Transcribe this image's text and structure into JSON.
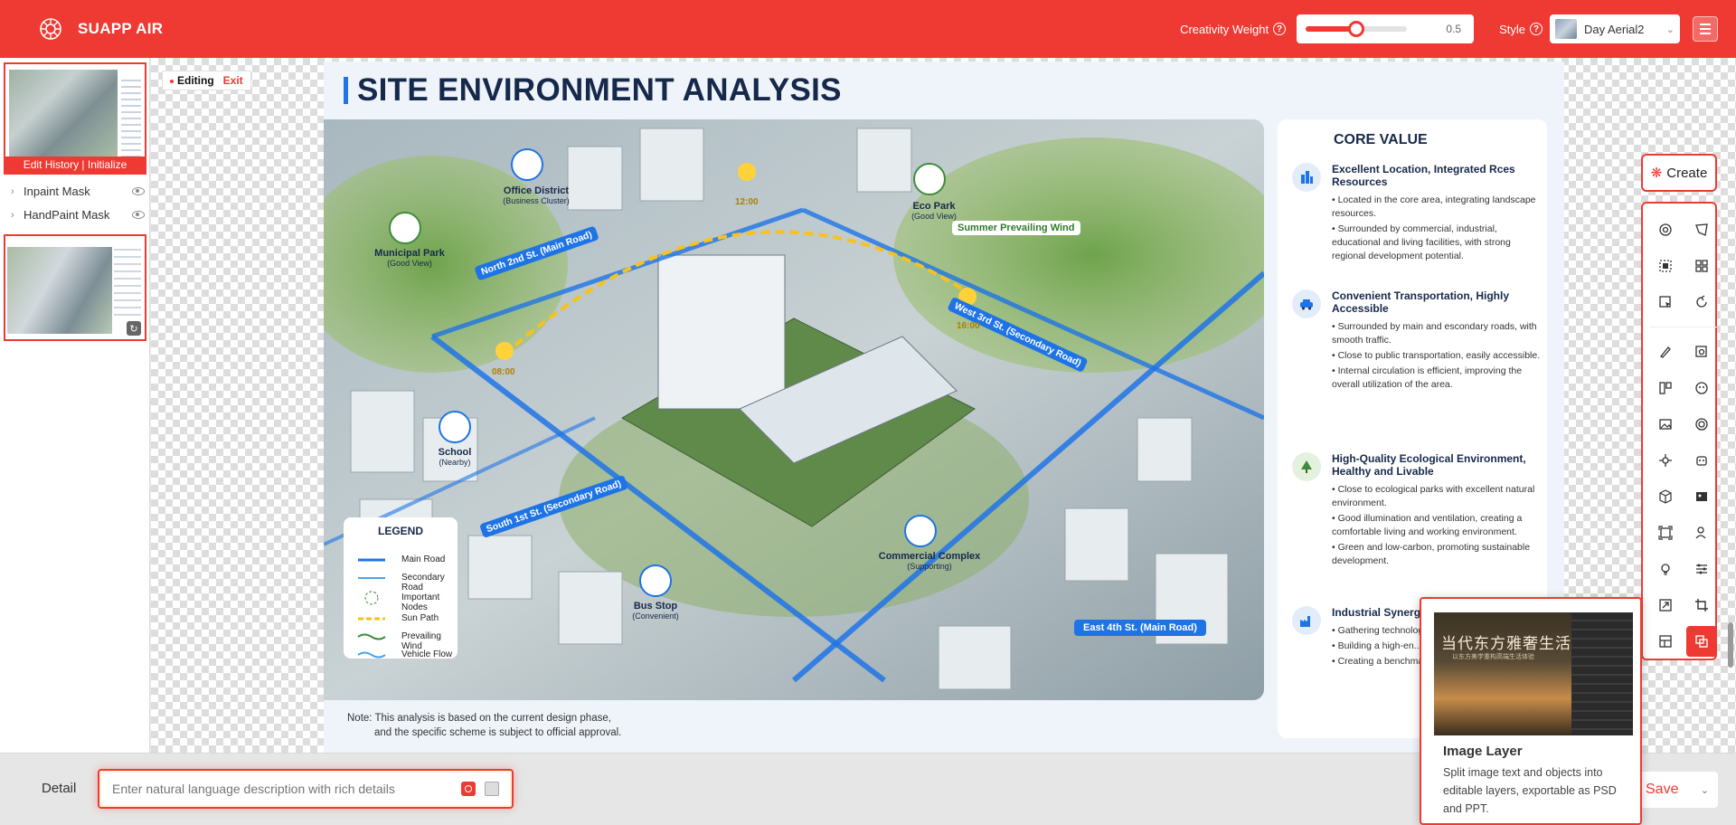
{
  "app": {
    "name": "SUAPP AIR"
  },
  "header": {
    "creativity_label": "Creativity Weight",
    "creativity_value": 0.5,
    "creativity_value_text": "0.5",
    "style_label": "Style",
    "style_value": "Day Aerial2",
    "help_glyph": "?"
  },
  "left_panel": {
    "thumb1_bar": "Edit History | Initialize",
    "layers": [
      {
        "label": "Inpaint Mask"
      },
      {
        "label": "HandPaint Mask"
      }
    ]
  },
  "canvas": {
    "editing_label": "Editing",
    "exit_label": "Exit"
  },
  "poster": {
    "title": "SITE ENVIRONMENT ANALYSIS",
    "note_line1": "Note: This analysis is based on the current design phase,",
    "note_line2": "and the specific scheme is subject to official approval.",
    "map_labels": {
      "office": "Office District",
      "office_sub": "(Business Cluster)",
      "municipal": "Municipal Park",
      "municipal_sub": "(Good View)",
      "eco": "Eco Park",
      "eco_sub": "(Good View)",
      "wind": "Summer Prevailing Wind",
      "north_road": "North 2nd St. (Main Road)",
      "west_road": "West 3rd St. (Secondary Road)",
      "south_road": "South 1st St. (Secondary Road)",
      "east_road": "East 4th St. (Main Road)",
      "school": "School",
      "school_sub": "(Nearby)",
      "bus": "Bus Stop",
      "bus_sub": "(Convenient)",
      "commercial": "Commercial Complex",
      "commercial_sub": "(Supporting)",
      "t1": "08:00",
      "t2": "12:00",
      "t3": "16:00"
    },
    "legend": {
      "title": "LEGEND",
      "items": [
        "Main Road",
        "Secondary Road",
        "Important Nodes",
        "Sun Path",
        "Prevailing Wind",
        "Vehicle Flow"
      ]
    },
    "core_value": {
      "title": "CORE VALUE",
      "items": [
        {
          "head": "Excellent Location, Integrated Rces Resources",
          "bullets": [
            "• Located in the core area, integrating landscape resources.",
            "• Surrounded by commercial, industrial, educational and living facilities, with strong regional development potential."
          ]
        },
        {
          "head": "Convenient Transportation, Highly Accessible",
          "bullets": [
            "• Surrounded by main and escondary roads, with smooth traffic.",
            "• Close to public transportation, easily accessible.",
            "• Internal circulation is efficient, improving the overall utilization of the area."
          ]
        },
        {
          "head": "High-Quality Ecological Environment, Healthy and Livable",
          "bullets": [
            "• Close to ecological parks with excellent natural environment.",
            "• Good illumination and ventilation, creating a comfortable living and working environment.",
            "• Green and low-carbon, promoting sustainable development."
          ]
        },
        {
          "head": "Industrial Synergy, High Value Potential",
          "bullets": [
            "• Gathering technology, ... and resources to pro...",
            "• Building a high-en... living ecosystem.",
            "• Creating a benchmark for urban industry and..."
          ]
        }
      ]
    }
  },
  "toolbar": {
    "create_label": "Create"
  },
  "bottom": {
    "detail_label": "Detail",
    "detail_placeholder": "Enter natural language description with rich details",
    "save_label": "Save"
  },
  "tooltip": {
    "title": "Image Layer",
    "description": "Split image text and objects into editable layers, exportable as PSD and PPT.",
    "image_caption": "当代东方雅奢生活馆",
    "image_subcaption": "以东方美学重构高端生活体验"
  },
  "colors": {
    "accent": "#ee3a32",
    "navy": "#17294a",
    "road_blue": "#1e74e6"
  }
}
